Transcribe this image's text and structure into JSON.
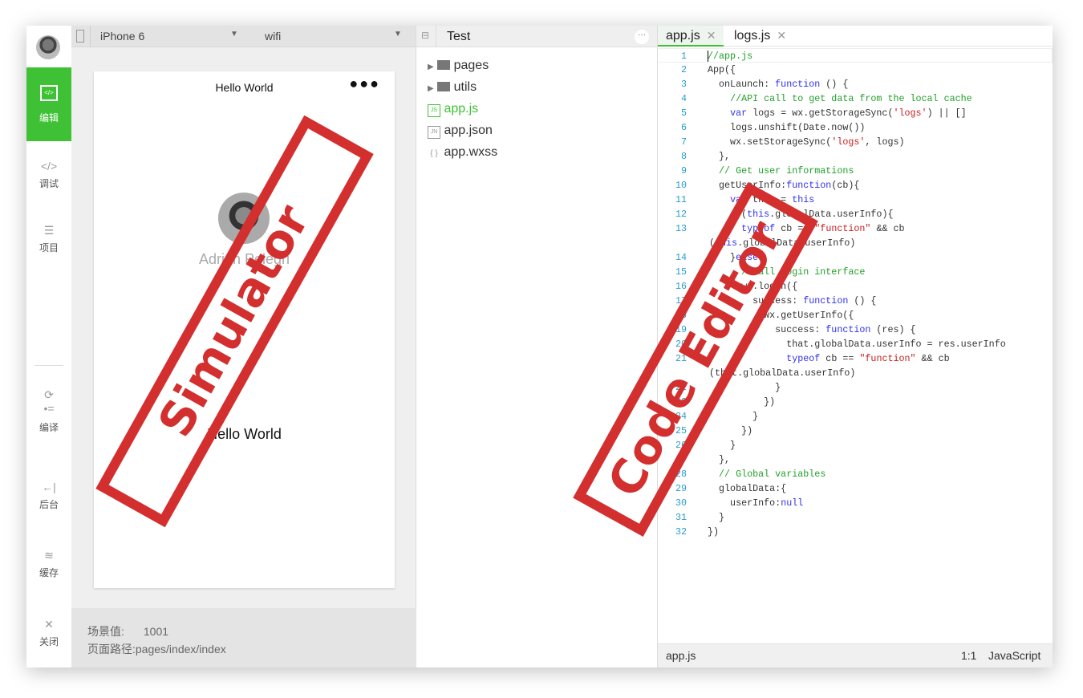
{
  "sidebar": {
    "items": [
      {
        "label": "编辑",
        "icon": "code-box-icon"
      },
      {
        "label": "调试",
        "icon": "code-icon"
      },
      {
        "label": "项目",
        "icon": "menu-icon"
      },
      {
        "label": "编译",
        "icon": "compile-icon"
      },
      {
        "label": "后台",
        "icon": "background-icon"
      },
      {
        "label": "缓存",
        "icon": "layers-icon"
      },
      {
        "label": "关闭",
        "icon": "close-icon"
      }
    ]
  },
  "simulator": {
    "device": "iPhone 6",
    "network": "wifi",
    "nav_title": "Hello World",
    "user_name": "Adrien Pelegri",
    "body_text": "Hello World",
    "scene_label": "场景值:",
    "scene_value": "1001",
    "path_label": "页面路径:",
    "path_value": "pages/index/index"
  },
  "tree": {
    "project": "Test",
    "items": [
      {
        "name": "pages",
        "type": "folder"
      },
      {
        "name": "utils",
        "type": "folder"
      },
      {
        "name": "app.js",
        "type": "js",
        "badge": "JS"
      },
      {
        "name": "app.json",
        "type": "json",
        "badge": "JN"
      },
      {
        "name": "app.wxss",
        "type": "wxss",
        "badge": "{ }"
      }
    ]
  },
  "editor": {
    "tabs": [
      {
        "label": "app.js",
        "active": true
      },
      {
        "label": "logs.js",
        "active": false
      }
    ],
    "status": {
      "file": "app.js",
      "position": "1:1",
      "language": "JavaScript"
    },
    "lines": [
      {
        "n": "1",
        "segs": [
          [
            "c",
            "//app.js"
          ]
        ]
      },
      {
        "n": "2",
        "segs": [
          [
            "",
            "App({"
          ]
        ]
      },
      {
        "n": "3",
        "segs": [
          [
            "",
            "  onLaunch: "
          ],
          [
            "k",
            "function"
          ],
          [
            "",
            " () {"
          ]
        ]
      },
      {
        "n": "4",
        "segs": [
          [
            "",
            "    "
          ],
          [
            "c",
            "//API call to get data from the local cache"
          ]
        ]
      },
      {
        "n": "5",
        "segs": [
          [
            "",
            "    "
          ],
          [
            "k",
            "var"
          ],
          [
            "",
            " logs = wx.getStorageSync("
          ],
          [
            "s",
            "'logs'"
          ],
          [
            "",
            ") || []"
          ]
        ]
      },
      {
        "n": "6",
        "segs": [
          [
            "",
            "    logs.unshift(Date.now())"
          ]
        ]
      },
      {
        "n": "7",
        "segs": [
          [
            "",
            "    wx.setStorageSync("
          ],
          [
            "s",
            "'logs'"
          ],
          [
            "",
            ", logs)"
          ]
        ]
      },
      {
        "n": "8",
        "segs": [
          [
            "",
            "  },"
          ]
        ]
      },
      {
        "n": "9",
        "segs": [
          [
            "",
            "  "
          ],
          [
            "c",
            "// Get user informations"
          ]
        ]
      },
      {
        "n": "10",
        "segs": [
          [
            "",
            "  getUserInfo:"
          ],
          [
            "k",
            "function"
          ],
          [
            "",
            "(cb){"
          ]
        ]
      },
      {
        "n": "11",
        "segs": [
          [
            "",
            "    "
          ],
          [
            "k",
            "var"
          ],
          [
            "",
            " that = "
          ],
          [
            "k",
            "this"
          ]
        ]
      },
      {
        "n": "12",
        "segs": [
          [
            "",
            "    "
          ],
          [
            "k",
            "if"
          ],
          [
            "",
            "("
          ],
          [
            "k",
            "this"
          ],
          [
            "",
            ".globalData.userInfo){"
          ]
        ]
      },
      {
        "n": "13",
        "segs": [
          [
            "",
            "      "
          ],
          [
            "k",
            "typeof"
          ],
          [
            "",
            " cb == "
          ],
          [
            "s",
            "\"function\""
          ],
          [
            "",
            " && cb"
          ]
        ],
        "wrap": [
          [
            "",
            "("
          ],
          [
            "k",
            "this"
          ],
          [
            "",
            ".globalData.userInfo)"
          ]
        ]
      },
      {
        "n": "14",
        "segs": [
          [
            "",
            "    }"
          ],
          [
            "k",
            "else"
          ],
          [
            "",
            "{"
          ]
        ]
      },
      {
        "n": "15",
        "segs": [
          [
            "",
            "      "
          ],
          [
            "c",
            "//Call login interface"
          ]
        ]
      },
      {
        "n": "16",
        "segs": [
          [
            "",
            "      wx.login({"
          ]
        ]
      },
      {
        "n": "17",
        "segs": [
          [
            "",
            "        success: "
          ],
          [
            "k",
            "function"
          ],
          [
            "",
            " () {"
          ]
        ]
      },
      {
        "n": "18",
        "segs": [
          [
            "",
            "          wx.getUserInfo({"
          ]
        ]
      },
      {
        "n": "19",
        "segs": [
          [
            "",
            "            success: "
          ],
          [
            "k",
            "function"
          ],
          [
            "",
            " (res) {"
          ]
        ]
      },
      {
        "n": "20",
        "segs": [
          [
            "",
            "              that.globalData.userInfo = res.userInfo"
          ]
        ]
      },
      {
        "n": "21",
        "segs": [
          [
            "",
            "              "
          ],
          [
            "k",
            "typeof"
          ],
          [
            "",
            " cb == "
          ],
          [
            "s",
            "\"function\""
          ],
          [
            "",
            " && cb"
          ]
        ],
        "wrap": [
          [
            "",
            "(that.globalData.userInfo)"
          ]
        ]
      },
      {
        "n": "22",
        "segs": [
          [
            "",
            "            }"
          ]
        ]
      },
      {
        "n": "23",
        "segs": [
          [
            "",
            "          })"
          ]
        ]
      },
      {
        "n": "24",
        "segs": [
          [
            "",
            "        }"
          ]
        ]
      },
      {
        "n": "25",
        "segs": [
          [
            "",
            "      })"
          ]
        ]
      },
      {
        "n": "26",
        "segs": [
          [
            "",
            "    }"
          ]
        ]
      },
      {
        "n": "27",
        "segs": [
          [
            "",
            "  },"
          ]
        ]
      },
      {
        "n": "28",
        "segs": [
          [
            "",
            "  "
          ],
          [
            "c",
            "// Global variables"
          ]
        ]
      },
      {
        "n": "29",
        "segs": [
          [
            "",
            "  globalData:{"
          ]
        ]
      },
      {
        "n": "30",
        "segs": [
          [
            "",
            "    userInfo:"
          ],
          [
            "k",
            "null"
          ]
        ]
      },
      {
        "n": "31",
        "segs": [
          [
            "",
            "  }"
          ]
        ]
      },
      {
        "n": "32",
        "segs": [
          [
            "",
            "})"
          ]
        ]
      }
    ]
  },
  "annotations": {
    "simulator": "Simulator",
    "editor": "Code Editor"
  },
  "colors": {
    "accent": "#3fc136",
    "stamp": "#d32f2f",
    "keyword": "#3030ee",
    "comment": "#22a02a",
    "string": "#c81e1e",
    "line_number": "#2a9dc8"
  }
}
